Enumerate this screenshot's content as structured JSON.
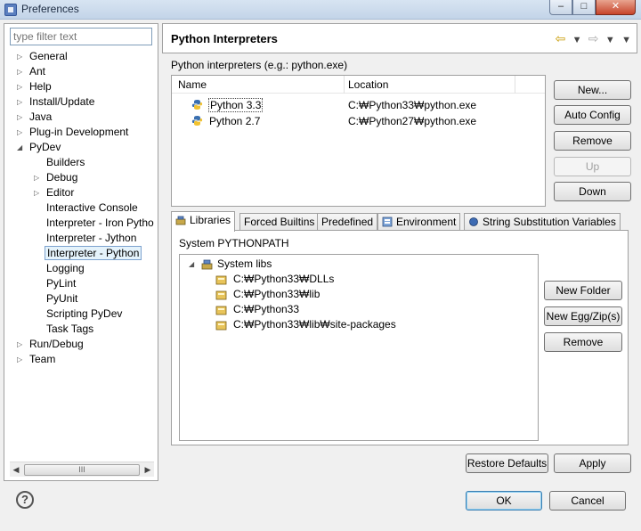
{
  "window": {
    "title": "Preferences",
    "min_label": "–",
    "max_label": "□",
    "close_label": "✕"
  },
  "sidebar": {
    "filter_placeholder": "type filter text",
    "items": [
      {
        "label": "General"
      },
      {
        "label": "Ant"
      },
      {
        "label": "Help"
      },
      {
        "label": "Install/Update"
      },
      {
        "label": "Java"
      },
      {
        "label": "Plug-in Development"
      },
      {
        "label": "PyDev"
      },
      {
        "label": "Builders"
      },
      {
        "label": "Debug"
      },
      {
        "label": "Editor"
      },
      {
        "label": "Interactive Console"
      },
      {
        "label": "Interpreter - Iron Pytho"
      },
      {
        "label": "Interpreter - Jython"
      },
      {
        "label": "Interpreter - Python"
      },
      {
        "label": "Logging"
      },
      {
        "label": "PyLint"
      },
      {
        "label": "PyUnit"
      },
      {
        "label": "Scripting PyDev"
      },
      {
        "label": "Task Tags"
      },
      {
        "label": "Run/Debug"
      },
      {
        "label": "Team"
      }
    ],
    "scroll_thumb": "III"
  },
  "main": {
    "title": "Python Interpreters",
    "description": "Python interpreters (e.g.: python.exe)",
    "columns": {
      "name": "Name",
      "location": "Location"
    },
    "interpreters": [
      {
        "name": "Python 3.3",
        "location": "C:₩Python33₩python.exe"
      },
      {
        "name": "Python 2.7",
        "location": "C:₩Python27₩python.exe"
      }
    ],
    "buttons": {
      "new": "New...",
      "auto_config": "Auto Config",
      "remove": "Remove",
      "up": "Up",
      "down": "Down"
    },
    "tabs": [
      {
        "label": "Libraries"
      },
      {
        "label": "Forced Builtins"
      },
      {
        "label": "Predefined"
      },
      {
        "label": "Environment"
      },
      {
        "label": "String Substitution Variables"
      }
    ],
    "libraries": {
      "pythonpath_label": "System PYTHONPATH",
      "root": "System libs",
      "paths": [
        "C:₩Python33₩DLLs",
        "C:₩Python33₩lib",
        "C:₩Python33",
        "C:₩Python33₩lib₩site-packages"
      ],
      "buttons": {
        "new_folder": "New Folder",
        "new_egg": "New Egg/Zip(s)",
        "remove": "Remove"
      }
    },
    "restore_defaults": "Restore Defaults",
    "apply": "Apply"
  },
  "footer": {
    "help_icon": "?",
    "ok": "OK",
    "cancel": "Cancel"
  }
}
